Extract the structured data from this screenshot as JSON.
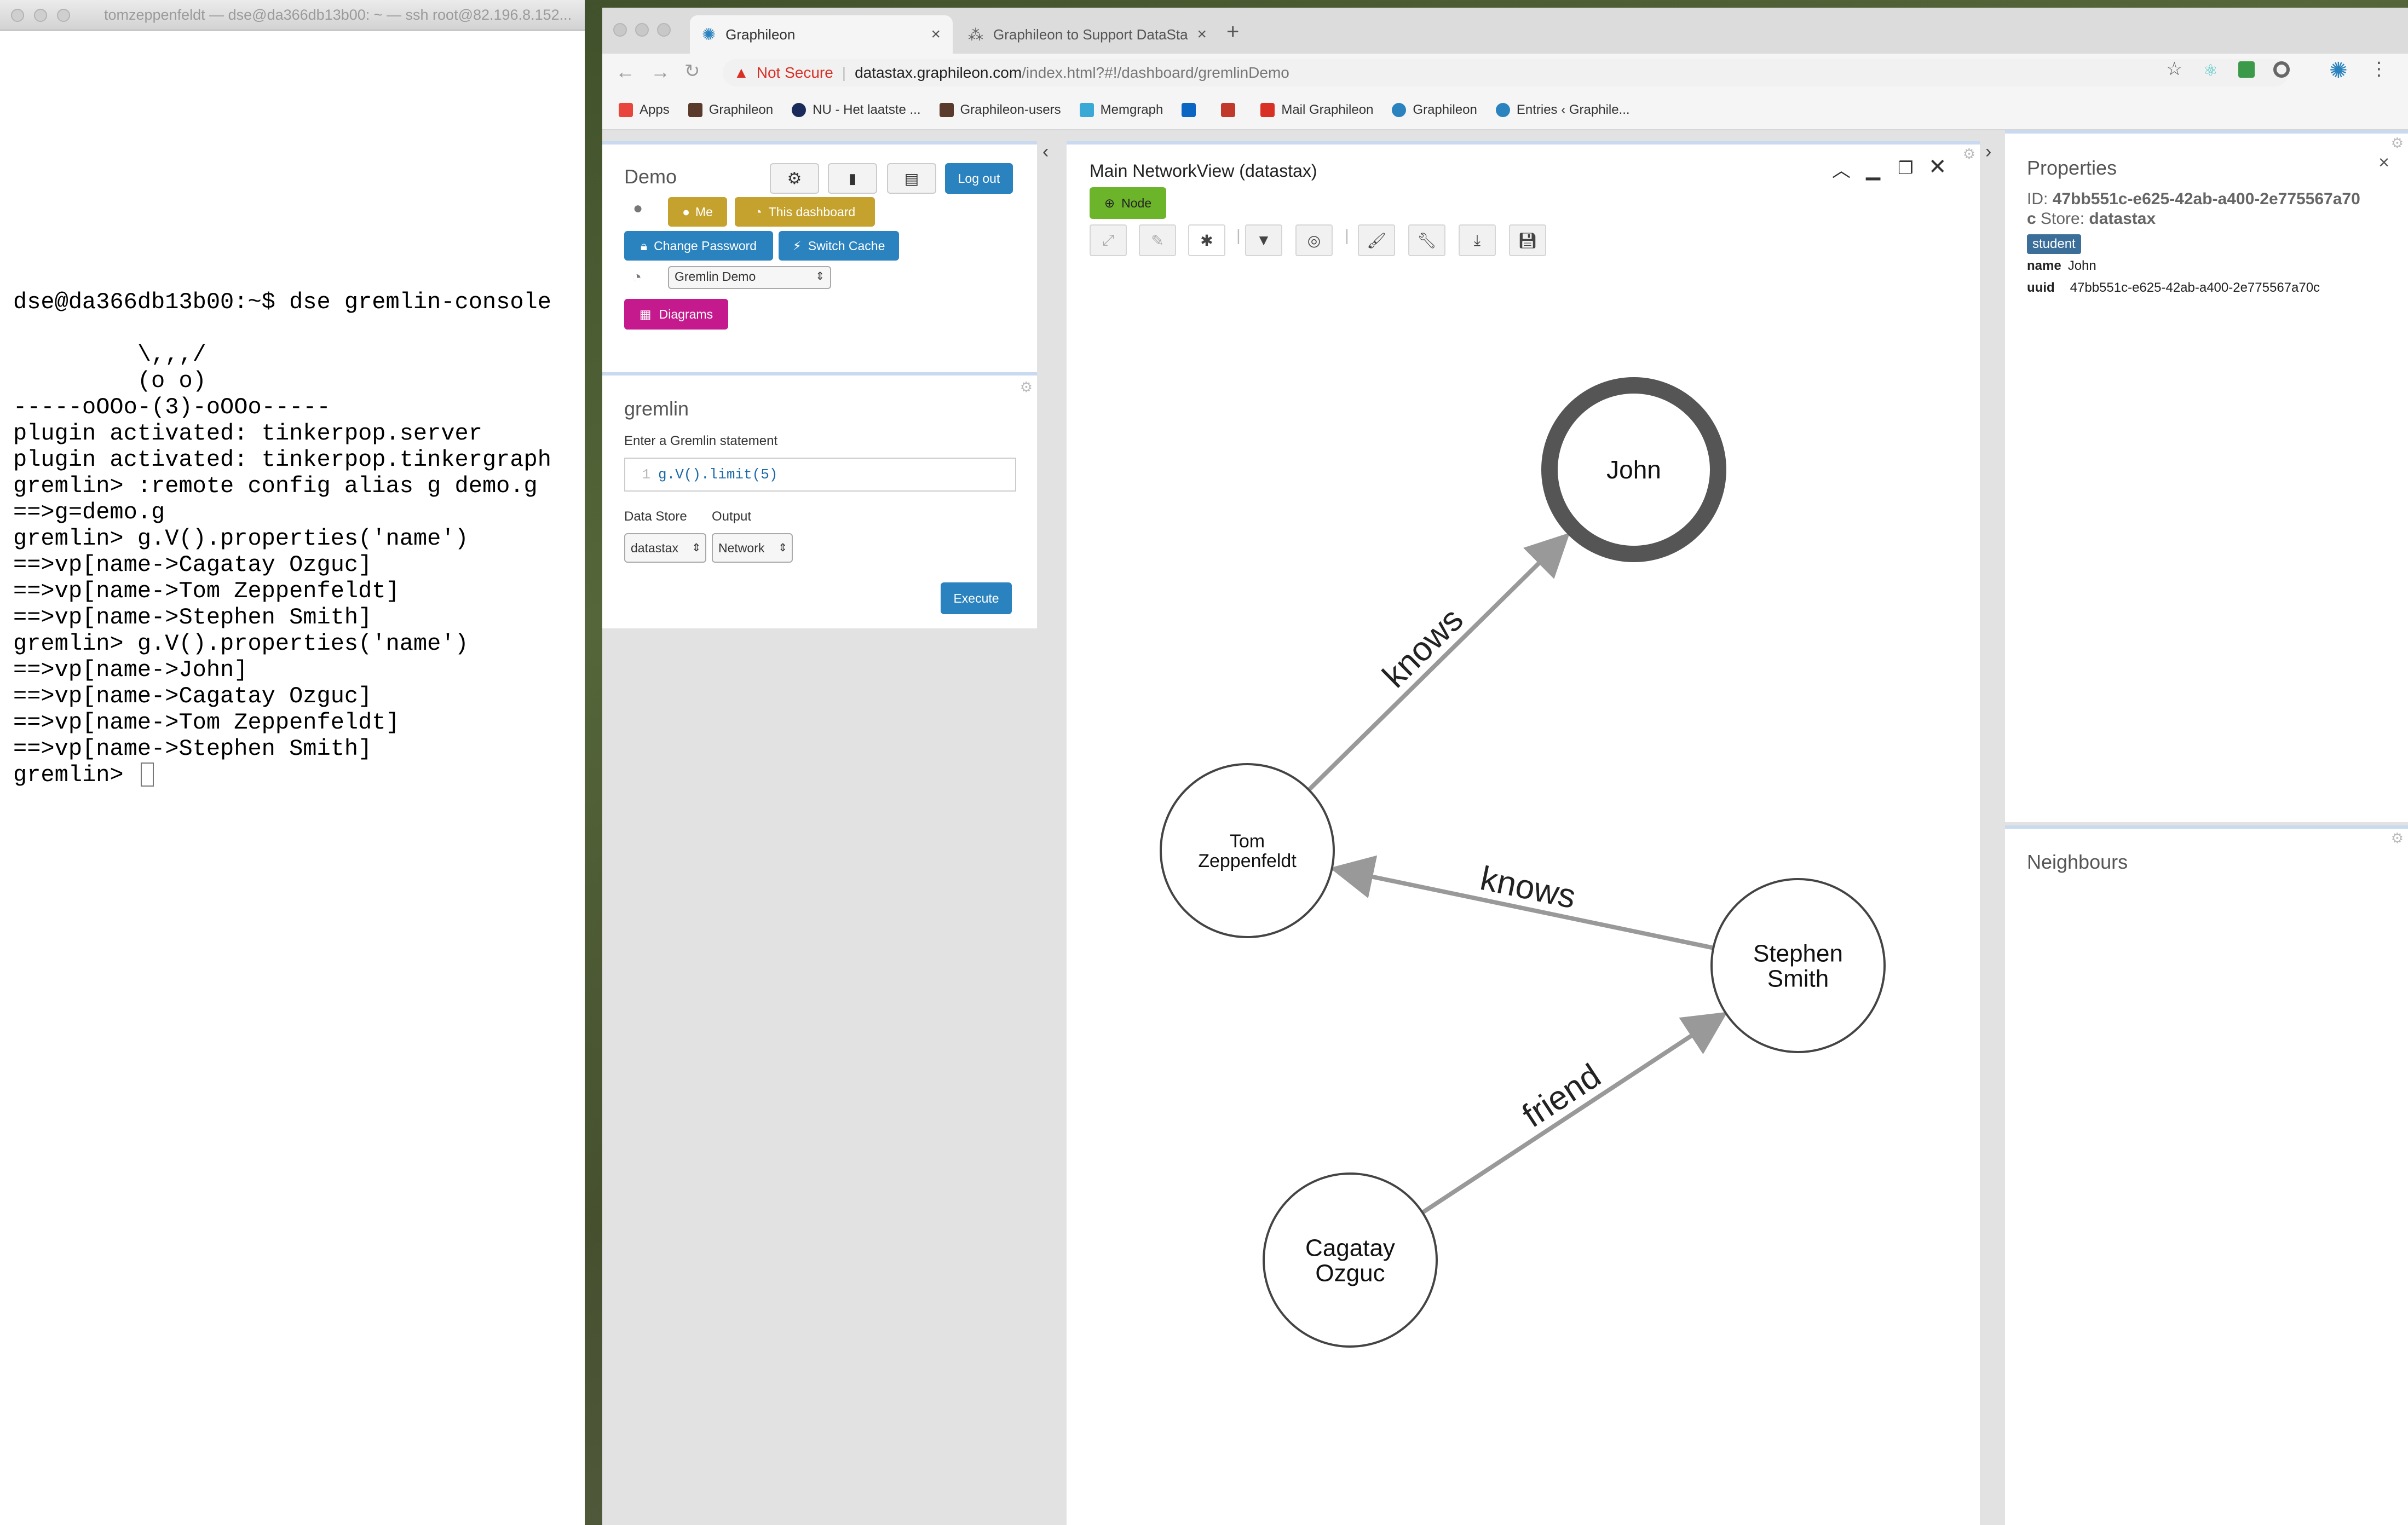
{
  "terminal": {
    "title": "tomzeppenfeldt — dse@da366db13b00: ~ — ssh root@82.196.8.152...",
    "lines": [
      "dse@da366db13b00:~$ dse gremlin-console",
      "",
      "         \\,,,/",
      "         (o o)",
      "-----oOOo-(3)-oOOo-----",
      "plugin activated: tinkerpop.server",
      "plugin activated: tinkerpop.tinkergraph",
      "gremlin> :remote config alias g demo.g",
      "==>g=demo.g",
      "gremlin> g.V().properties('name')",
      "==>vp[name->Cagatay Ozguc]",
      "==>vp[name->Tom Zeppenfeldt]",
      "==>vp[name->Stephen Smith]",
      "gremlin> g.V().properties('name')",
      "==>vp[name->John]",
      "==>vp[name->Cagatay Ozguc]",
      "==>vp[name->Tom Zeppenfeldt]",
      "==>vp[name->Stephen Smith]"
    ],
    "prompt": "gremlin> "
  },
  "browser": {
    "tabs": [
      {
        "label": "Graphileon",
        "active": true
      },
      {
        "label": "Graphileon to Support DataSta",
        "active": false
      }
    ],
    "new_tab": "+",
    "security": "Not Secure",
    "url_host": "datastax.graphileon.com",
    "url_path": "/index.html?#!/dashboard/gremlinDemo",
    "bookmarks": [
      {
        "label": "Apps",
        "color": "#e8453c"
      },
      {
        "label": "Graphileon",
        "color": "#5a3a2a"
      },
      {
        "label": "NU - Het laatste ...",
        "color": "#1a2a5a"
      },
      {
        "label": "Graphileon-users",
        "color": "#5a3a2a"
      },
      {
        "label": "Memgraph",
        "color": "#3aa9d6"
      },
      {
        "label": "",
        "color": "#0a66c2"
      },
      {
        "label": "",
        "color": "#c0392b"
      },
      {
        "label": "Mail Graphileon",
        "color": "#d93025"
      },
      {
        "label": "Graphileon",
        "color": "#2a82be"
      },
      {
        "label": "Entries ‹ Graphile...",
        "color": "#2a82be"
      }
    ]
  },
  "demo_panel": {
    "title": "Demo",
    "logout": "Log out",
    "me": "Me",
    "this_dashboard": "This dashboard",
    "change_password": "Change Password",
    "switch_cache": "Switch Cache",
    "dashboard_select": "Gremlin Demo",
    "diagrams": "Diagrams"
  },
  "gremlin_panel": {
    "title": "gremlin",
    "label": "Enter a Gremlin statement",
    "line_number": "1",
    "code": "g.V().limit(5)",
    "datastore_label": "Data Store",
    "output_label": "Output",
    "datastore_value": "datastax",
    "output_value": "Network",
    "execute": "Execute"
  },
  "network": {
    "title": "Main NetworkView (datastax)",
    "node_button": "Node",
    "nodes": [
      {
        "id": "john",
        "label": [
          "John"
        ],
        "selected": true
      },
      {
        "id": "tom",
        "label": [
          "Tom",
          "Zeppenfeldt"
        ],
        "selected": false
      },
      {
        "id": "stephen",
        "label": [
          "Stephen",
          "Smith"
        ],
        "selected": false
      },
      {
        "id": "cagatay",
        "label": [
          "Cagatay",
          "Ozguc"
        ],
        "selected": false
      }
    ],
    "edges": [
      {
        "from": "tom",
        "to": "john",
        "label": "knows"
      },
      {
        "from": "stephen",
        "to": "tom",
        "label": "knows"
      },
      {
        "from": "cagatay",
        "to": "stephen",
        "label": "friend"
      }
    ]
  },
  "properties": {
    "title": "Properties",
    "id_label": "ID:",
    "id_value": "47bb551c-e625-42ab-a400-2e775567a70c",
    "store_label": "Store:",
    "store_value": "datastax",
    "badge": "student",
    "rows": [
      {
        "key": "name",
        "value": "John"
      },
      {
        "key": "uuid",
        "value": "47bb551c-e625-42ab-a400-2e775567a70c"
      }
    ]
  },
  "neighbours": {
    "title": "Neighbours"
  },
  "colors": {
    "accent": "#2a82be",
    "yellow": "#c5a12d",
    "magenta": "#c41a8d",
    "green": "#6cb52a",
    "badge": "#3c6e9a"
  }
}
